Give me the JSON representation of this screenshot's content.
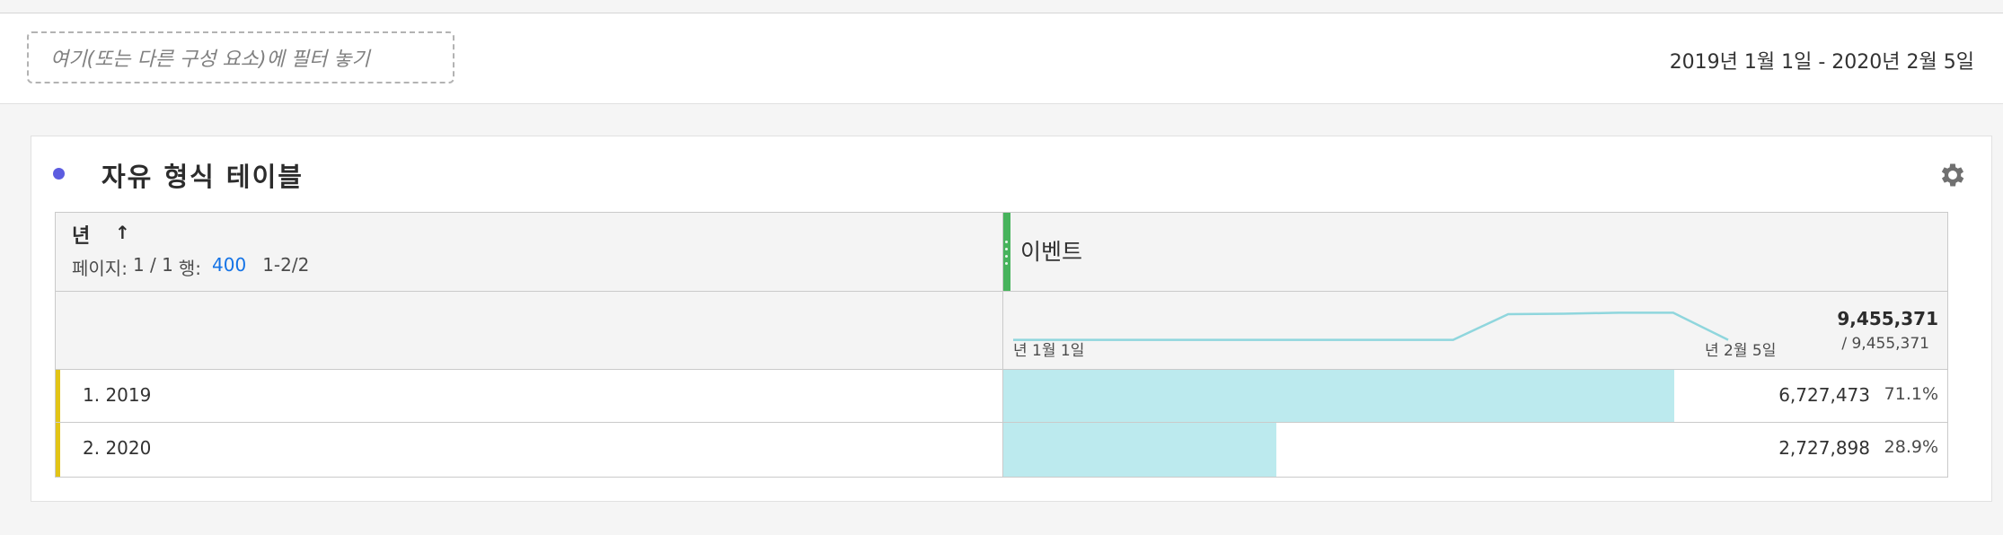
{
  "filter": {
    "placeholder": "여기(또는 다른 구성 요소)에 필터 놓기",
    "date_range": "2019년 1월 1일 - 2020년 2월 5일"
  },
  "panel": {
    "title": "자유 형식 테이블",
    "icon": "gear-icon",
    "accent_color": "#5c5ce0"
  },
  "table": {
    "metric": {
      "name": "이벤트",
      "color": "#47b35c"
    },
    "dimension": {
      "name": "년",
      "sort_icon": "arrow-up-icon"
    },
    "pagination": {
      "page_label": "페이지:",
      "page": "1 / 1",
      "rows_label": "행:",
      "rows_per_page": "400",
      "range": "1-2/2"
    },
    "sparkline": {
      "start_label": "년 1월 1일",
      "end_label": "년 2월 5일",
      "color": "#8fd6dd",
      "values": [
        0.2,
        0.2,
        0.2,
        0.2,
        0.2,
        0.2,
        0.2,
        0.2,
        0.2,
        0.75,
        0.76,
        0.78,
        0.78,
        0.2
      ]
    },
    "total": "9,455,371",
    "total_sub": "/ 9,455,371",
    "rows": [
      {
        "label": "1. 2019",
        "value": "6,727,473",
        "percent": "71.1%",
        "fraction": 0.711
      },
      {
        "label": "2. 2020",
        "value": "2,727,898",
        "percent": "28.9%",
        "fraction": 0.289
      }
    ],
    "bar_color": "#bceaee",
    "row_marker_color": "#e2c416"
  }
}
